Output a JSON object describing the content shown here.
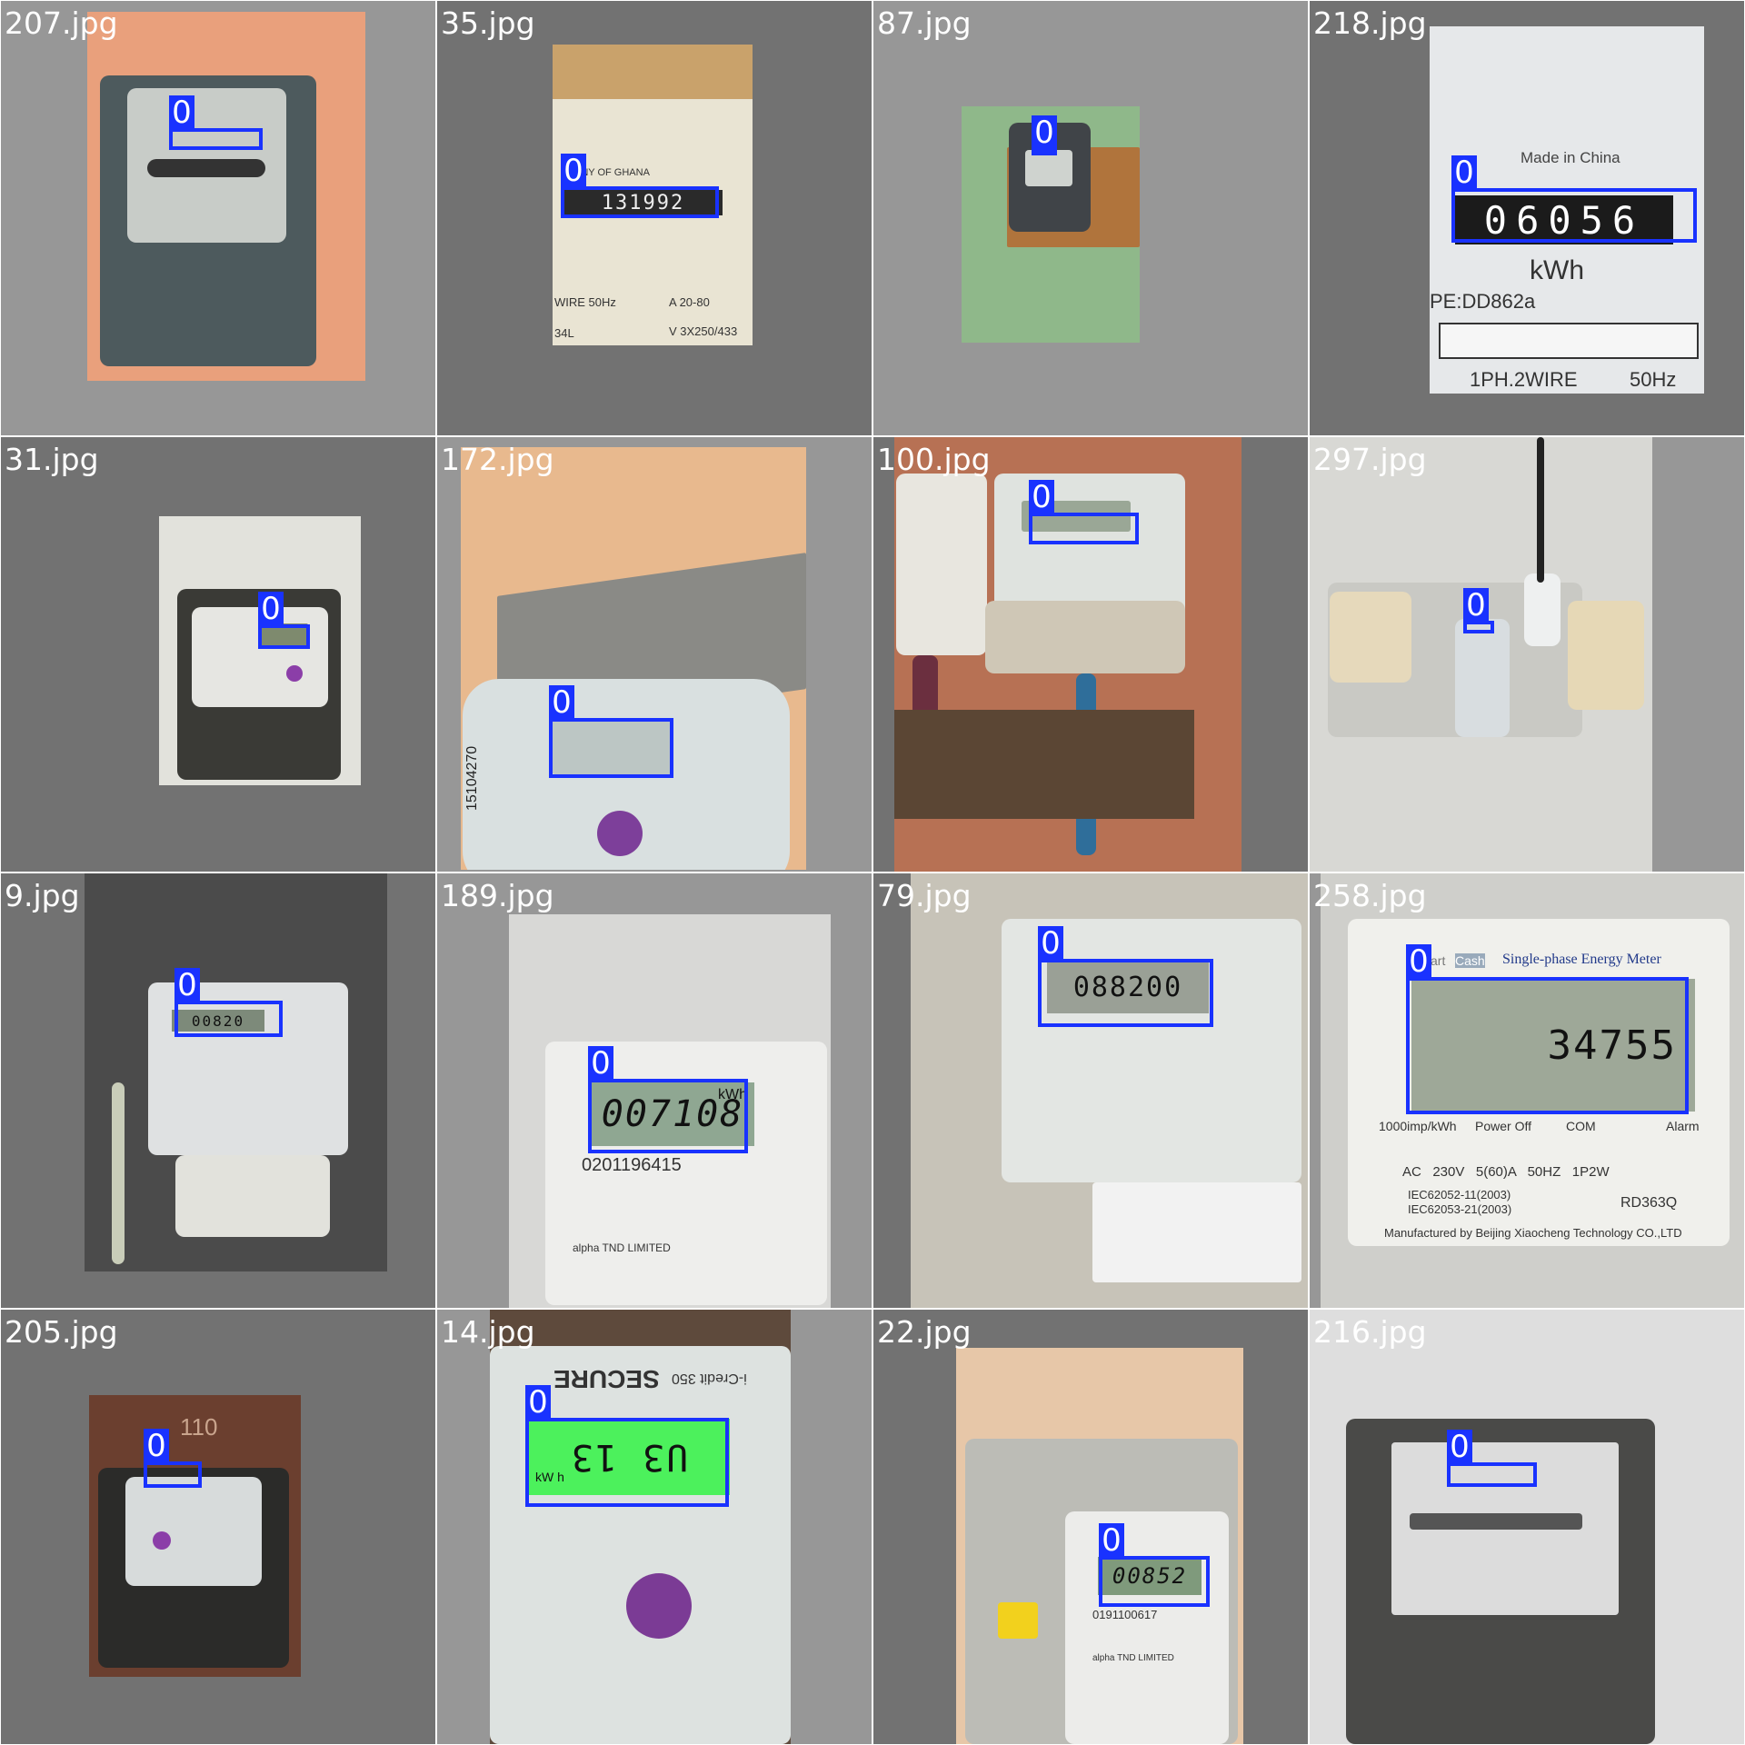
{
  "tiles": [
    {
      "filename": "207.jpg",
      "label": "0"
    },
    {
      "filename": "35.jpg",
      "label": "0",
      "texts": {
        "company": "ANY OF GHANA",
        "reading": "131992",
        "wire": "WIRE 50Hz",
        "amps": "A 20-80",
        "volts": "V 3X250/433",
        "code": "34L"
      }
    },
    {
      "filename": "87.jpg",
      "label": "0"
    },
    {
      "filename": "218.jpg",
      "label": "0",
      "texts": {
        "origin": "Made in China",
        "reading": "06056",
        "unit": "kWh",
        "type": "PE:DD862a",
        "spec_a": "1PH.2WIRE",
        "spec_b": "50Hz"
      }
    },
    {
      "filename": "31.jpg",
      "label": "0"
    },
    {
      "filename": "172.jpg",
      "label": "0",
      "texts": {
        "serial": "15104270"
      }
    },
    {
      "filename": "100.jpg",
      "label": "0"
    },
    {
      "filename": "297.jpg",
      "label": "0"
    },
    {
      "filename": "9.jpg",
      "label": "0",
      "texts": {
        "reading": "00820"
      }
    },
    {
      "filename": "189.jpg",
      "label": "0",
      "texts": {
        "reading": "007108",
        "unit": "kWh",
        "serial": "0201196415",
        "maker": "alpha TND LIMITED"
      }
    },
    {
      "filename": "79.jpg",
      "label": "0",
      "texts": {
        "reading": "088200"
      }
    },
    {
      "filename": "258.jpg",
      "label": "0",
      "texts": {
        "brand_a": "Smart",
        "brand_b": "Cash",
        "title": "Single-phase Energy Meter",
        "reading": "34755",
        "imp": "1000imp/kWh",
        "power_off": "Power Off",
        "com": "COM",
        "alarm": "Alarm",
        "ratings": "AC   230V   5(60)A   50HZ   1P2W",
        "std_a": "IEC62052-11(2003)",
        "std_b": "IEC62053-21(2003)",
        "model": "RD363Q",
        "maker": "Manufactured by Beijing Xiaocheng Technology CO.,LTD"
      }
    },
    {
      "filename": "205.jpg",
      "label": "0",
      "texts": {
        "note": "110"
      }
    },
    {
      "filename": "14.jpg",
      "label": "0",
      "texts": {
        "brand": "SECURE",
        "model": "i-Credit 350",
        "reading": "U3 13",
        "unit": "kW h"
      }
    },
    {
      "filename": "22.jpg",
      "label": "0",
      "texts": {
        "reading": "00852",
        "serial": "0191100617",
        "maker": "alpha TND LIMITED"
      }
    },
    {
      "filename": "216.jpg",
      "label": "0"
    }
  ],
  "colors": {
    "box": "#1932ff",
    "tag_text": "#ffffff",
    "filename_text": "#ffffff",
    "bg_dark": "#727272",
    "bg_light": "#979797"
  }
}
